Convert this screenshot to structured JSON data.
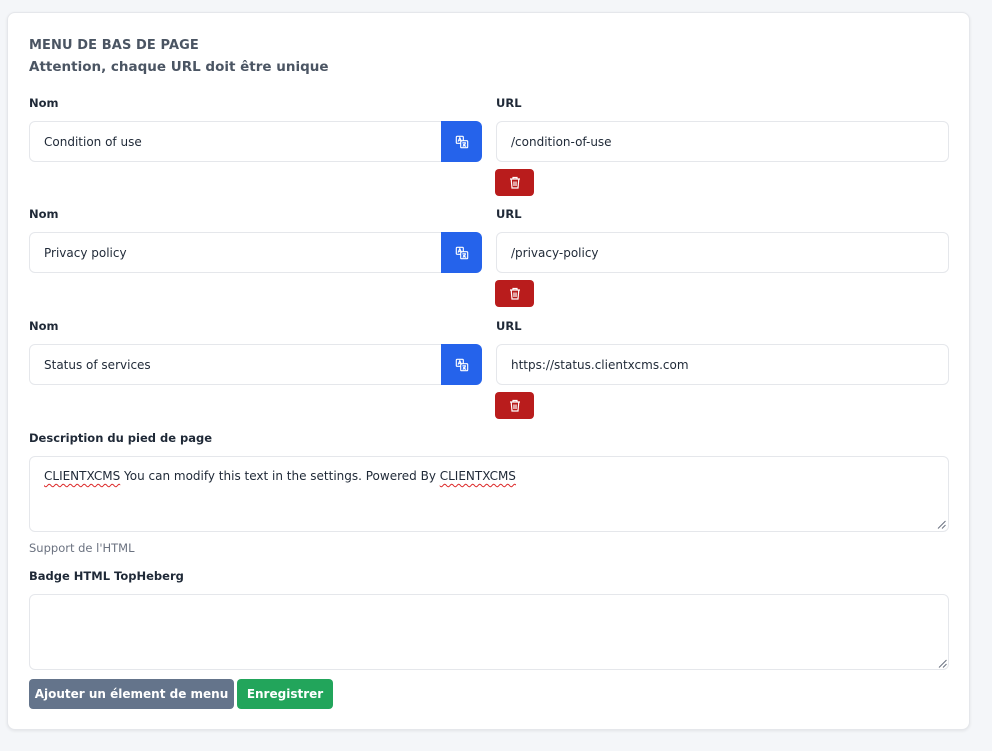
{
  "section": {
    "title": "MENU DE BAS DE PAGE",
    "subtitle": "Attention, chaque URL doit être unique"
  },
  "labels": {
    "name": "Nom",
    "url": "URL"
  },
  "menu_items": [
    {
      "name": "Condition of use",
      "url": "/condition-of-use"
    },
    {
      "name": "Privacy policy",
      "url": "/privacy-policy"
    },
    {
      "name": "Status of services",
      "url": "https://status.clientxcms.com"
    }
  ],
  "footer_description": {
    "label": "Description du pied de page",
    "word_1": "CLIENTXCMS",
    "middle_text": " You can modify this text in the settings. Powered By ",
    "word_2": "CLIENTXCMS",
    "help": "Support de l'HTML"
  },
  "badge": {
    "label": "Badge HTML TopHeberg",
    "value": ""
  },
  "actions": {
    "add_label": "Ajouter un élement de menu",
    "save_label": "Enregistrer"
  },
  "colors": {
    "primary": "#2563eb",
    "danger": "#b91c1c",
    "secondary": "#64748b",
    "success": "#22a55b"
  }
}
